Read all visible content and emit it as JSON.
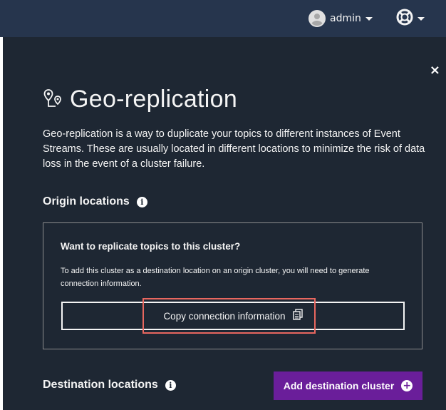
{
  "header": {
    "user_name": "admin",
    "user_icon": "user-avatar-icon",
    "help_icon": "help-lifebuoy-icon"
  },
  "panel": {
    "close_glyph": "×",
    "title": "Geo-replication",
    "title_icon": "geo-location-icon",
    "description": "Geo-replication is a way to duplicate your topics to different instances of Event Streams. These are usually located in different locations to minimize the risk of data loss in the event of a cluster failure.",
    "origin": {
      "heading": "Origin locations",
      "question": "Want to replicate topics to this cluster?",
      "text": "To add this cluster as a destination location on an origin cluster, you will need to generate connection information.",
      "copy_button_label": "Copy connection information",
      "copy_icon": "copy-icon"
    },
    "destination": {
      "heading": "Destination locations",
      "add_button_label": "Add destination cluster",
      "add_icon": "add-circle-icon"
    }
  },
  "colors": {
    "header_bg": "#26354d",
    "panel_bg": "#1e2733",
    "primary_button": "#6a1e9a",
    "highlight": "#e8675f"
  }
}
